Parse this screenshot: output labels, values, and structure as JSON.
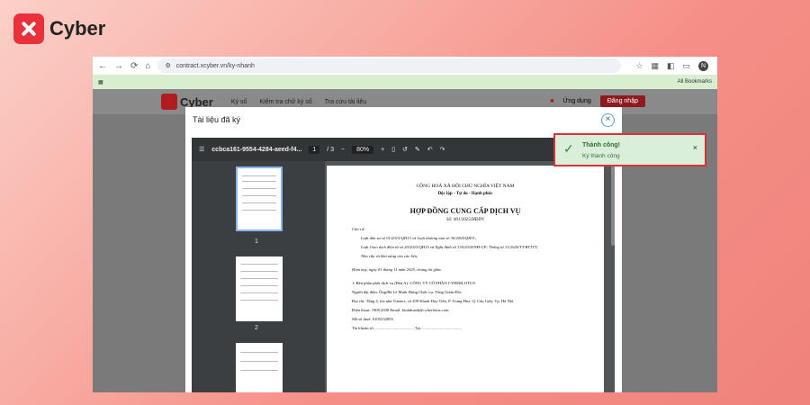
{
  "brand": {
    "name": "Cyber"
  },
  "browser": {
    "url": "contract.xcyber.vn/ky-nhanh",
    "back": "←",
    "forward": "→",
    "reload": "⟳",
    "home": "⌂",
    "profile_initial": "N",
    "all_bookmarks": "All Bookmarks"
  },
  "site": {
    "logo": "Cyber",
    "nav": [
      "Ký số",
      "Kiểm tra chữ ký số",
      "Tra cứu tài liệu"
    ],
    "apps": "Ứng dụng",
    "login": "Đăng nhập"
  },
  "modal": {
    "title": "Tài liệu đã ký"
  },
  "pdf": {
    "filename": "ccbca161-9554-4284-aeed-f4...",
    "page_current": "1",
    "page_total": "/ 3",
    "zoom": "80%",
    "thumb_labels": [
      "1",
      "2"
    ],
    "doc": {
      "nation": "CỘNG HOÀ XÃ HỘI CHỦ NGHĨA VIỆT NAM",
      "motto": "Độc lập - Tự do - Hạnh phúc",
      "title": "HỢP ĐỒNG CUNG CẤP DỊCH VỤ",
      "number": "Số: 001/2025/HĐDV",
      "basis": "Căn cứ:",
      "items": [
        "Luật dân sự số 91/2015/QH13 và Luật thương mại số 36/2005/QH11;",
        "Luật Giao dịch điện tử số 20/2023/QH15 và Nghị định số 130/2018/NĐ-CP; Thông tư 31/2020/TT-BTTTT;",
        "Nhu cầu và khả năng của các bên;"
      ],
      "date": "Hôm nay, ngày 01 tháng 11 năm 2025, chúng tôi gồm:",
      "party_a": "1. Bên phân phối dịch vụ (Bên A): CÔNG TY CỔ PHẦN CYBERLOTUS",
      "rep": "Người đại diện: Ông/Bà Lê Minh Hưng          Chức vụ: Tổng Giám Đốc",
      "address": "Địa chỉ: Tầng 4, tòa nhà Vinatex, số 209 Khuất Duy Tiến, P. Trung Hòa, Q. Cầu Giấy, Tp. Hà Nội.",
      "phone": "Điện thoại:      1900.2038                   Email: kinhdoanh@cyberlotus.com",
      "tax": "Mã số thuế:      0105232093",
      "account": "Tài khoản số: ..................................... Tại: ......................................"
    }
  },
  "toast": {
    "title": "Thành công!",
    "message": "Ký thành công",
    "close": "×"
  }
}
